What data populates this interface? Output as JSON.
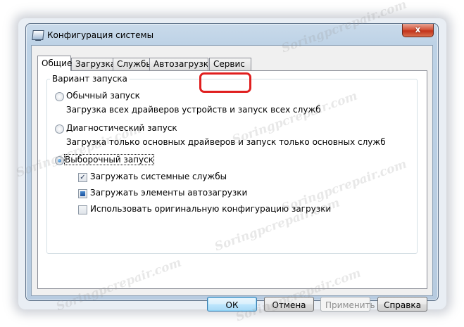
{
  "window": {
    "title": "Конфигурация системы",
    "close_symbol": "x"
  },
  "tabs": [
    {
      "label": "Общие",
      "active": true
    },
    {
      "label": "Загрузка",
      "active": false
    },
    {
      "label": "Службы",
      "active": false
    },
    {
      "label": "Автозагрузка",
      "active": false
    },
    {
      "label": "Сервис",
      "active": false,
      "highlighted": true
    }
  ],
  "startup_group": {
    "label": "Вариант запуска",
    "options": [
      {
        "label": "Обычный запуск",
        "description": "Загрузка всех драйверов устройств и запуск всех служб",
        "selected": false
      },
      {
        "label": "Диагностический запуск",
        "description": "Загрузка только основных драйверов и запуск только основных служб",
        "selected": false
      },
      {
        "label": "Выборочный запуск",
        "description": "",
        "selected": true
      }
    ],
    "selective_options": [
      {
        "label": "Загружать системные службы",
        "state": "checked"
      },
      {
        "label": "Загружать элементы автозагрузки",
        "state": "mixed"
      },
      {
        "label": "Использовать оригинальную конфигурацию загрузки",
        "state": "unchecked"
      }
    ]
  },
  "buttons": {
    "ok": "ОК",
    "cancel": "Отмена",
    "apply": "Применить",
    "help": "Справка"
  },
  "watermark_text": "Soringpcrepair.com",
  "colors": {
    "highlight_border": "#e01f1f",
    "close_button": "#c2331a"
  }
}
